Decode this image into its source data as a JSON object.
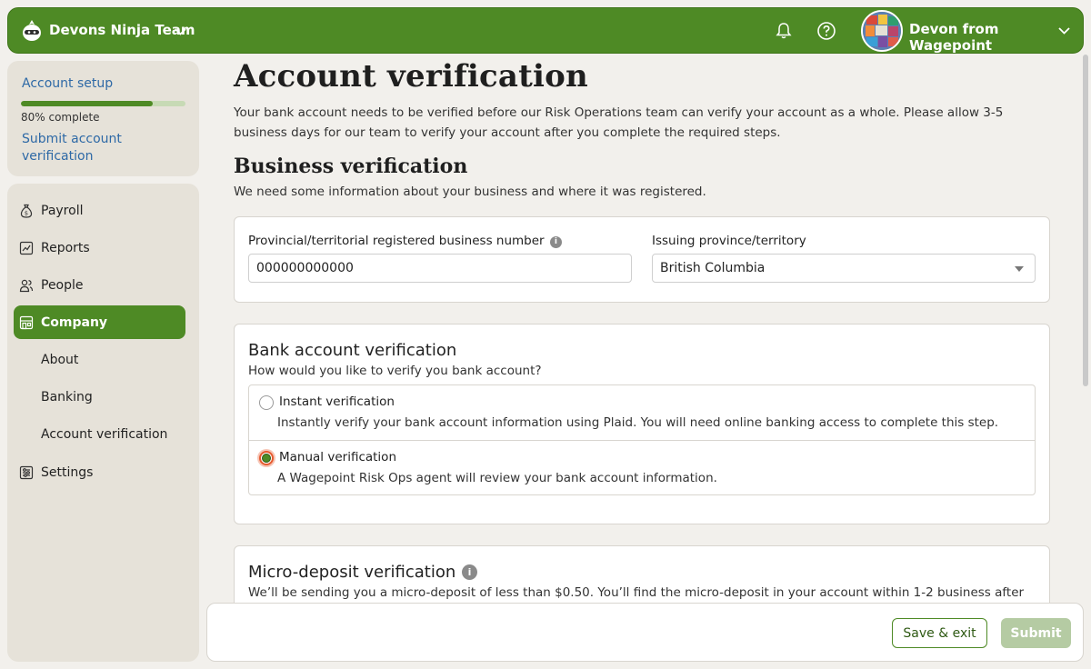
{
  "header": {
    "team_name": "Devons Ninja Team",
    "user_name": "Devon from Wagepoint",
    "brand_color": "#4e8a25",
    "icons": [
      "logo-icon",
      "chevron-down-icon",
      "bell-icon",
      "help-icon",
      "avatar"
    ]
  },
  "setup": {
    "title": "Account setup",
    "progress_fraction": 0.8,
    "progress_text": "80% complete",
    "link": "Submit account verification"
  },
  "sidebar": {
    "items": [
      {
        "label": "Payroll",
        "icon": "money-bag-icon"
      },
      {
        "label": "Reports",
        "icon": "chart-icon"
      },
      {
        "label": "People",
        "icon": "people-icon"
      },
      {
        "label": "Company",
        "icon": "store-icon",
        "active": true
      },
      {
        "label": "Settings",
        "icon": "settings-icon"
      }
    ],
    "sub_items": [
      "About",
      "Banking",
      "Account verification"
    ]
  },
  "main": {
    "title": "Account verification",
    "intro": "Your bank account needs to be verified before our Risk Operations team can verify your account as a whole. Please allow 3-5 business days for our team to verify your account after you complete the required steps.",
    "business": {
      "title": "Business verification",
      "subtitle": "We need some information about your business and where it was registered.",
      "number_label": "Provincial/territorial registered business number",
      "number_value": "000000000000",
      "province_label": "Issuing province/territory",
      "province_value": "British Columbia"
    },
    "bank": {
      "title": "Bank account verification",
      "subtitle": "How would you like to verify you bank account?",
      "options": [
        {
          "title": "Instant verification",
          "desc": "Instantly verify your bank account information using Plaid. You will need online banking access to complete this step.",
          "selected": false
        },
        {
          "title": "Manual verification",
          "desc": "A Wagepoint Risk Ops agent will review your bank account information.",
          "selected": true
        }
      ]
    },
    "micro": {
      "title": "Micro-deposit verification",
      "desc": "We’ll be sending you a micro-deposit of less than $0.50. You’ll find the micro-deposit in your account within 1-2 business after"
    }
  },
  "footer": {
    "save_label": "Save & exit",
    "submit_label": "Submit"
  }
}
